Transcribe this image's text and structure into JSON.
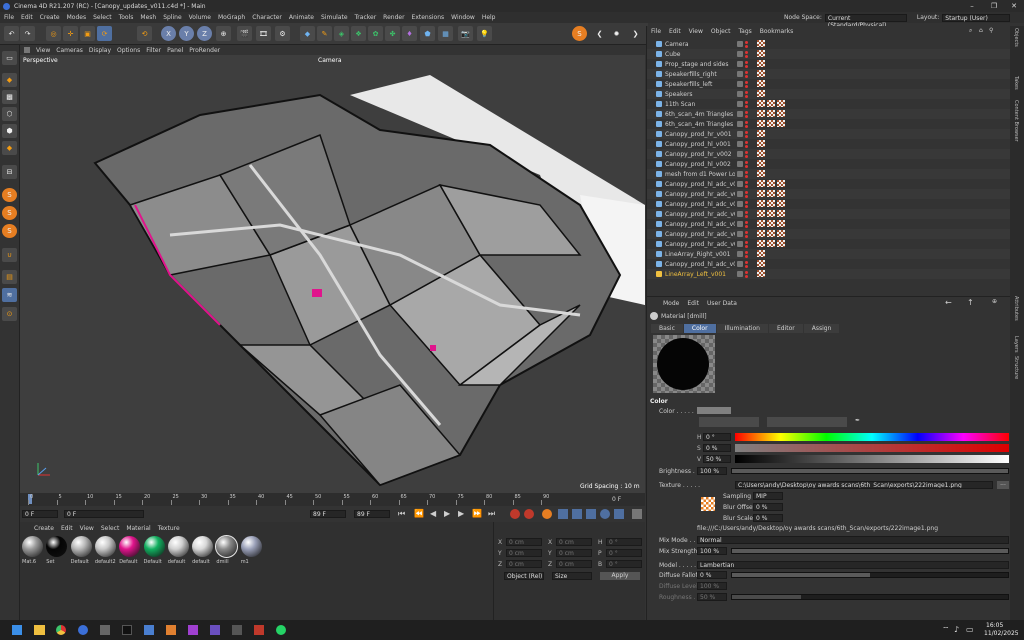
{
  "window": {
    "title": "Cinema 4D R21.207 (RC) - [Canopy_updates_v011.c4d *] - Main",
    "controls": [
      "–",
      "❐",
      "✕"
    ]
  },
  "menu": [
    "File",
    "Edit",
    "Create",
    "Modes",
    "Select",
    "Tools",
    "Mesh",
    "Spline",
    "Volume",
    "MoGraph",
    "Character",
    "Animate",
    "Simulate",
    "Tracker",
    "Render",
    "Extensions",
    "Window",
    "Help"
  ],
  "node_space": {
    "label": "Node Space:",
    "value": "Current (Standard/Physical)"
  },
  "layout": {
    "label": "Layout:",
    "value": "Startup (User)"
  },
  "toolbar_axes": [
    "X",
    "Y",
    "Z"
  ],
  "viewport": {
    "menu": [
      "View",
      "Cameras",
      "Display",
      "Options",
      "Filter",
      "Panel",
      "ProRender"
    ],
    "name": "Perspective",
    "camera": "Camera",
    "grid": "Grid Spacing : 10 m"
  },
  "timeline": {
    "ticks": [
      "0",
      "5",
      "10",
      "15",
      "20",
      "25",
      "30",
      "35",
      "40",
      "45",
      "50",
      "55",
      "60",
      "65",
      "70",
      "75",
      "80",
      "85",
      "90"
    ],
    "end": "0 F"
  },
  "transport": {
    "start": "0 F",
    "cur": "0 F",
    "end1": "89 F",
    "end2": "89 F"
  },
  "materials": {
    "menu": [
      "Create",
      "Edit",
      "View",
      "Select",
      "Material",
      "Texture"
    ],
    "items": [
      {
        "name": "Mat.6",
        "color": "#9a9a9a"
      },
      {
        "name": "Set",
        "color": "#050505"
      },
      {
        "name": "Default",
        "color": "#b8b8b8"
      },
      {
        "name": "default2",
        "color": "#c8c8c8"
      },
      {
        "name": "Default",
        "color": "#e0148c"
      },
      {
        "name": "Default",
        "color": "#12b060"
      },
      {
        "name": "default",
        "color": "#d0d0d0"
      },
      {
        "name": "default",
        "color": "#d8d8d8"
      },
      {
        "name": "dmill",
        "color": "#8a8a8a"
      },
      {
        "name": "m1",
        "color": "#9aa0b8"
      }
    ]
  },
  "coords": {
    "rows": [
      [
        "X",
        "0 cm",
        "X",
        "0 cm",
        "H",
        "0 °"
      ],
      [
        "Y",
        "0 cm",
        "Y",
        "0 cm",
        "P",
        "0 °"
      ],
      [
        "Z",
        "0 cm",
        "Z",
        "0 cm",
        "B",
        "0 °"
      ]
    ],
    "mode": "Object (Rel)",
    "size": "Size",
    "apply": "Apply"
  },
  "objects": {
    "menu": [
      "File",
      "Edit",
      "View",
      "Object",
      "Tags",
      "Bookmarks"
    ],
    "items": [
      "Camera",
      "Cube",
      "Prop_stage and sides",
      "Speakerfills_right",
      "Speakerfills_left",
      "Speakers",
      "11th Scan",
      "6th_scan_4m Triangles HR",
      "6th_scan_4m Triangles HL",
      "Canopy_prod_hr_v001",
      "Canopy_prod_hl_v001",
      "Canopy_prod_hr_v002",
      "Canopy_prod_hl_v002",
      "mesh from d1 Power Lofter",
      "Canopy_prod_hl_adc_v004",
      "Canopy_prod_hr_adc_v004",
      "Canopy_prod_hl_adc_v005",
      "Canopy_prod_hr_adc_v005",
      "Canopy_prod_hl_adc_v006",
      "Canopy_prod_hr_adc_v006",
      "Canopy_prod_hr_adc_v008",
      "LineArray_Right_v001",
      "Canopy_prod_hl_adc_v009",
      "LineArray_Left_v001"
    ]
  },
  "attributes": {
    "menu": [
      "Mode",
      "Edit",
      "User Data"
    ],
    "material": "Material [dmill]",
    "tabs": [
      "Basic",
      "Color",
      "Illumination",
      "Editor",
      "Assign"
    ],
    "section": "Color",
    "color_label": "Color . . . . .",
    "h": "0 °",
    "s": "0 %",
    "v": "50 %",
    "brightness_label": "Brightness . . .",
    "brightness": "100 %",
    "texture_label": "Texture . . . . .",
    "texture_path": "C:\\Users\\andy\\Desktop\\oy awards scans\\6th_Scan\\exports\\222image1.png",
    "sampling_label": "Sampling",
    "sampling": "MIP",
    "blur_offset_label": "Blur Offset",
    "blur_offset": "0 %",
    "blur_scale_label": "Blur Scale",
    "blur_scale": "0 %",
    "file_path": "file:///C:/Users/andy/Desktop/oy awards scans/6th_Scan/exports/222image1.png",
    "mix_mode_label": "Mix Mode . . . . .",
    "mix_mode": "Normal",
    "mix_strength_label": "Mix Strength . .",
    "mix_strength": "100 %",
    "model_label": "Model . . . . . . .",
    "model": "Lambertian",
    "diffuse_falloff_label": "Diffuse Falloff",
    "diffuse_falloff": "0 %",
    "diffuse_level_label": "Diffuse Level . .",
    "diffuse_level": "100 %",
    "roughness_label": "Roughness . . . .",
    "roughness": "50 %"
  },
  "right_tabs": [
    "Objects",
    "Takes",
    "Content Browser",
    "Attributes",
    "Layers",
    "Structure"
  ],
  "taskbar": {
    "time": "16:05",
    "date": "11/02/2025"
  }
}
